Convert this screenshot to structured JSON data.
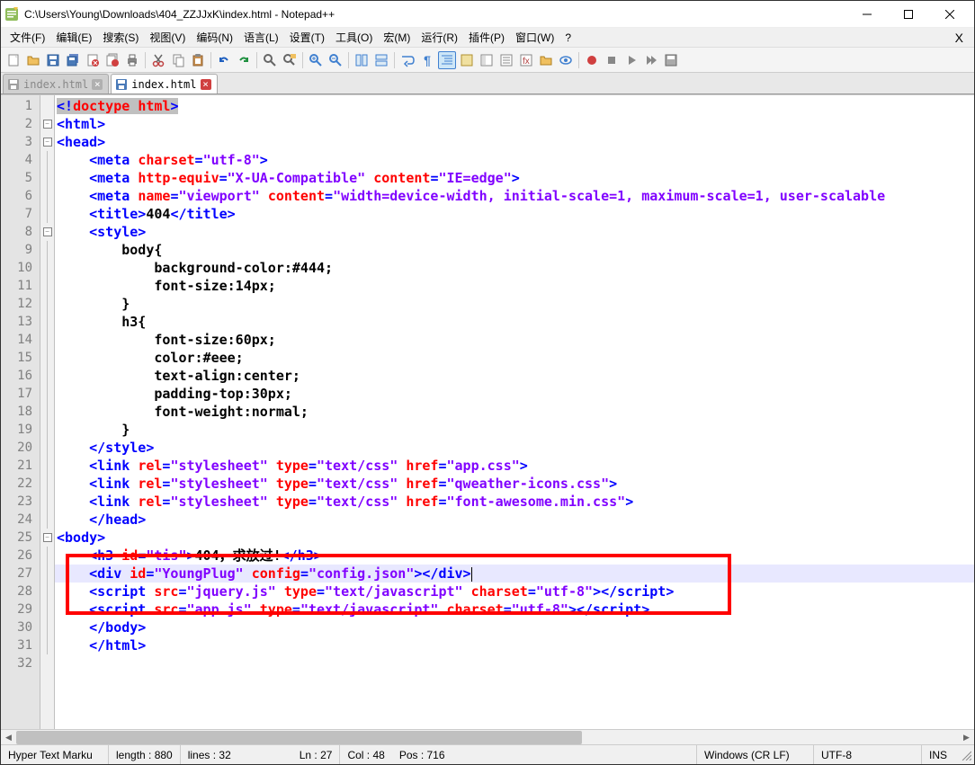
{
  "title": "C:\\Users\\Young\\Downloads\\404_ZZJJxK\\index.html - Notepad++",
  "menus": [
    "文件(F)",
    "编辑(E)",
    "搜索(S)",
    "视图(V)",
    "编码(N)",
    "语言(L)",
    "设置(T)",
    "工具(O)",
    "宏(M)",
    "运行(R)",
    "插件(P)",
    "窗口(W)",
    "?"
  ],
  "tabs": [
    {
      "name": "index.html",
      "active": false
    },
    {
      "name": "index.html",
      "active": true
    }
  ],
  "lines": {
    "count": 32,
    "content": [
      {
        "n": 1,
        "fold": "",
        "html": "<span class='sel'><span class='t-tag'>&lt;!</span><span class='t-attr'>doctype</span> <span class='t-attr'>html</span><span class='t-tag'>&gt;</span></span>"
      },
      {
        "n": 2,
        "fold": "box",
        "html": "<span class='t-tag'>&lt;html&gt;</span>"
      },
      {
        "n": 3,
        "fold": "box",
        "html": "<span class='t-tag'>&lt;head&gt;</span>"
      },
      {
        "n": 4,
        "fold": "line",
        "html": "<span class='t-tag'>&lt;meta</span> <span class='t-attr'>charset</span><span class='t-tag'>=</span><span class='t-val'>\"utf-8\"</span><span class='t-tag'>&gt;</span>"
      },
      {
        "n": 5,
        "fold": "line",
        "html": "<span class='t-tag'>&lt;meta</span> <span class='t-attr'>http-equiv</span><span class='t-tag'>=</span><span class='t-val'>\"X-UA-Compatible\"</span> <span class='t-attr'>content</span><span class='t-tag'>=</span><span class='t-val'>\"IE=edge\"</span><span class='t-tag'>&gt;</span>"
      },
      {
        "n": 6,
        "fold": "line",
        "html": "<span class='t-tag'>&lt;meta</span> <span class='t-attr'>name</span><span class='t-tag'>=</span><span class='t-val'>\"viewport\"</span> <span class='t-attr'>content</span><span class='t-tag'>=</span><span class='t-val'>\"width=device-width, initial-scale=1, maximum-scale=1, user-scalable</span>"
      },
      {
        "n": 7,
        "fold": "line",
        "html": "<span class='t-tag'>&lt;title&gt;</span><span class='t-text'>404</span><span class='t-tag'>&lt;/title&gt;</span>"
      },
      {
        "n": 8,
        "fold": "box",
        "html": "<span class='t-tag'>&lt;style&gt;</span>"
      },
      {
        "n": 9,
        "fold": "line",
        "html": "    <span class='t-kw'>body{</span>"
      },
      {
        "n": 10,
        "fold": "line",
        "html": "        <span class='t-kw'>background-color:#444;</span>"
      },
      {
        "n": 11,
        "fold": "line",
        "html": "        <span class='t-kw'>font-size:14px;</span>"
      },
      {
        "n": 12,
        "fold": "line",
        "html": "    <span class='t-kw'>}</span>"
      },
      {
        "n": 13,
        "fold": "line",
        "html": "    <span class='t-kw'>h3{</span>"
      },
      {
        "n": 14,
        "fold": "line",
        "html": "        <span class='t-kw'>font-size:60px;</span>"
      },
      {
        "n": 15,
        "fold": "line",
        "html": "        <span class='t-kw'>color:#eee;</span>"
      },
      {
        "n": 16,
        "fold": "line",
        "html": "        <span class='t-kw'>text-align:center;</span>"
      },
      {
        "n": 17,
        "fold": "line",
        "html": "        <span class='t-kw'>padding-top:30px;</span>"
      },
      {
        "n": 18,
        "fold": "line",
        "html": "        <span class='t-kw'>font-weight:normal;</span>"
      },
      {
        "n": 19,
        "fold": "line",
        "html": "    <span class='t-kw'>}</span>"
      },
      {
        "n": 20,
        "fold": "line",
        "html": "<span class='t-tag'>&lt;/style&gt;</span>"
      },
      {
        "n": 21,
        "fold": "line",
        "html": "<span class='t-tag'>&lt;link</span> <span class='t-attr'>rel</span><span class='t-tag'>=</span><span class='t-val'>\"stylesheet\"</span> <span class='t-attr'>type</span><span class='t-tag'>=</span><span class='t-val'>\"text/css\"</span> <span class='t-attr'>href</span><span class='t-tag'>=</span><span class='t-val'>\"app.css\"</span><span class='t-tag'>&gt;</span>"
      },
      {
        "n": 22,
        "fold": "line",
        "html": "<span class='t-tag'>&lt;link</span> <span class='t-attr'>rel</span><span class='t-tag'>=</span><span class='t-val'>\"stylesheet\"</span> <span class='t-attr'>type</span><span class='t-tag'>=</span><span class='t-val'>\"text/css\"</span> <span class='t-attr'>href</span><span class='t-tag'>=</span><span class='t-val'>\"qweather-icons.css\"</span><span class='t-tag'>&gt;</span>"
      },
      {
        "n": 23,
        "fold": "line",
        "html": "<span class='t-tag'>&lt;link</span> <span class='t-attr'>rel</span><span class='t-tag'>=</span><span class='t-val'>\"stylesheet\"</span> <span class='t-attr'>type</span><span class='t-tag'>=</span><span class='t-val'>\"text/css\"</span> <span class='t-attr'>href</span><span class='t-tag'>=</span><span class='t-val'>\"font-awesome.min.css\"</span><span class='t-tag'>&gt;</span>"
      },
      {
        "n": 24,
        "fold": "line",
        "html": "<span class='t-tag'>&lt;/head&gt;</span>"
      },
      {
        "n": 25,
        "fold": "box",
        "html": "<span class='t-tag'>&lt;body&gt;</span>"
      },
      {
        "n": 26,
        "fold": "line",
        "html": "<span class='t-tag'>&lt;h3</span> <span class='t-attr'>id</span><span class='t-tag'>=</span><span class='t-val'>\"tis\"</span><span class='t-tag'>&gt;</span><span class='t-text'>404，求放过!</span><span class='t-tag'>&lt;/h3&gt;</span>"
      },
      {
        "n": 27,
        "fold": "line",
        "current": true,
        "html": "<span class='t-tag'>&lt;div</span> <span class='t-attr'>id</span><span class='t-tag'>=</span><span class='t-val'>\"YoungPlug\"</span> <span class='t-attr'>config</span><span class='t-tag'>=</span><span class='t-val'>\"config.json\"</span><span class='t-tag'>&gt;&lt;/div&gt;</span><span class='caret'></span>"
      },
      {
        "n": 28,
        "fold": "line",
        "html": "<span class='t-tag'>&lt;script</span> <span class='t-attr'>src</span><span class='t-tag'>=</span><span class='t-val'>\"jquery.js\"</span> <span class='t-attr'>type</span><span class='t-tag'>=</span><span class='t-val'>\"text/javascript\"</span> <span class='t-attr'>charset</span><span class='t-tag'>=</span><span class='t-val'>\"utf-8\"</span><span class='t-tag'>&gt;&lt;/script&gt;</span>"
      },
      {
        "n": 29,
        "fold": "line",
        "html": "<span class='t-tag'>&lt;script</span> <span class='t-attr'>src</span><span class='t-tag'>=</span><span class='t-val'>\"app.js\"</span> <span class='t-attr'>type</span><span class='t-tag'>=</span><span class='t-val'>\"text/javascript\"</span> <span class='t-attr'>charset</span><span class='t-tag'>=</span><span class='t-val'>\"utf-8\"</span><span class='t-tag'>&gt;&lt;/script&gt;</span>"
      },
      {
        "n": 30,
        "fold": "line",
        "html": "<span class='t-tag'>&lt;/body&gt;</span>"
      },
      {
        "n": 31,
        "fold": "line",
        "html": "<span class='t-tag'>&lt;/html&gt;</span>"
      },
      {
        "n": 32,
        "fold": "",
        "html": ""
      }
    ],
    "indent_map": {
      "1": 0,
      "2": 0,
      "3": 0,
      "4": 1,
      "5": 1,
      "6": 1,
      "7": 1,
      "8": 1,
      "9": 1,
      "10": 1,
      "11": 1,
      "12": 1,
      "13": 1,
      "14": 1,
      "15": 1,
      "16": 1,
      "17": 1,
      "18": 1,
      "19": 1,
      "20": 1,
      "21": 1,
      "22": 1,
      "23": 1,
      "24": 1,
      "25": 0,
      "26": 1,
      "27": 1,
      "28": 1,
      "29": 1,
      "30": 1,
      "31": 1,
      "32": 0
    }
  },
  "status": {
    "lang": "Hyper Text Marku",
    "length": "length : 880",
    "lines": "lines : 32",
    "ln": "Ln : 27",
    "col": "Col : 48",
    "pos": "Pos : 716",
    "eol": "Windows (CR LF)",
    "enc": "UTF-8",
    "ins": "INS"
  }
}
